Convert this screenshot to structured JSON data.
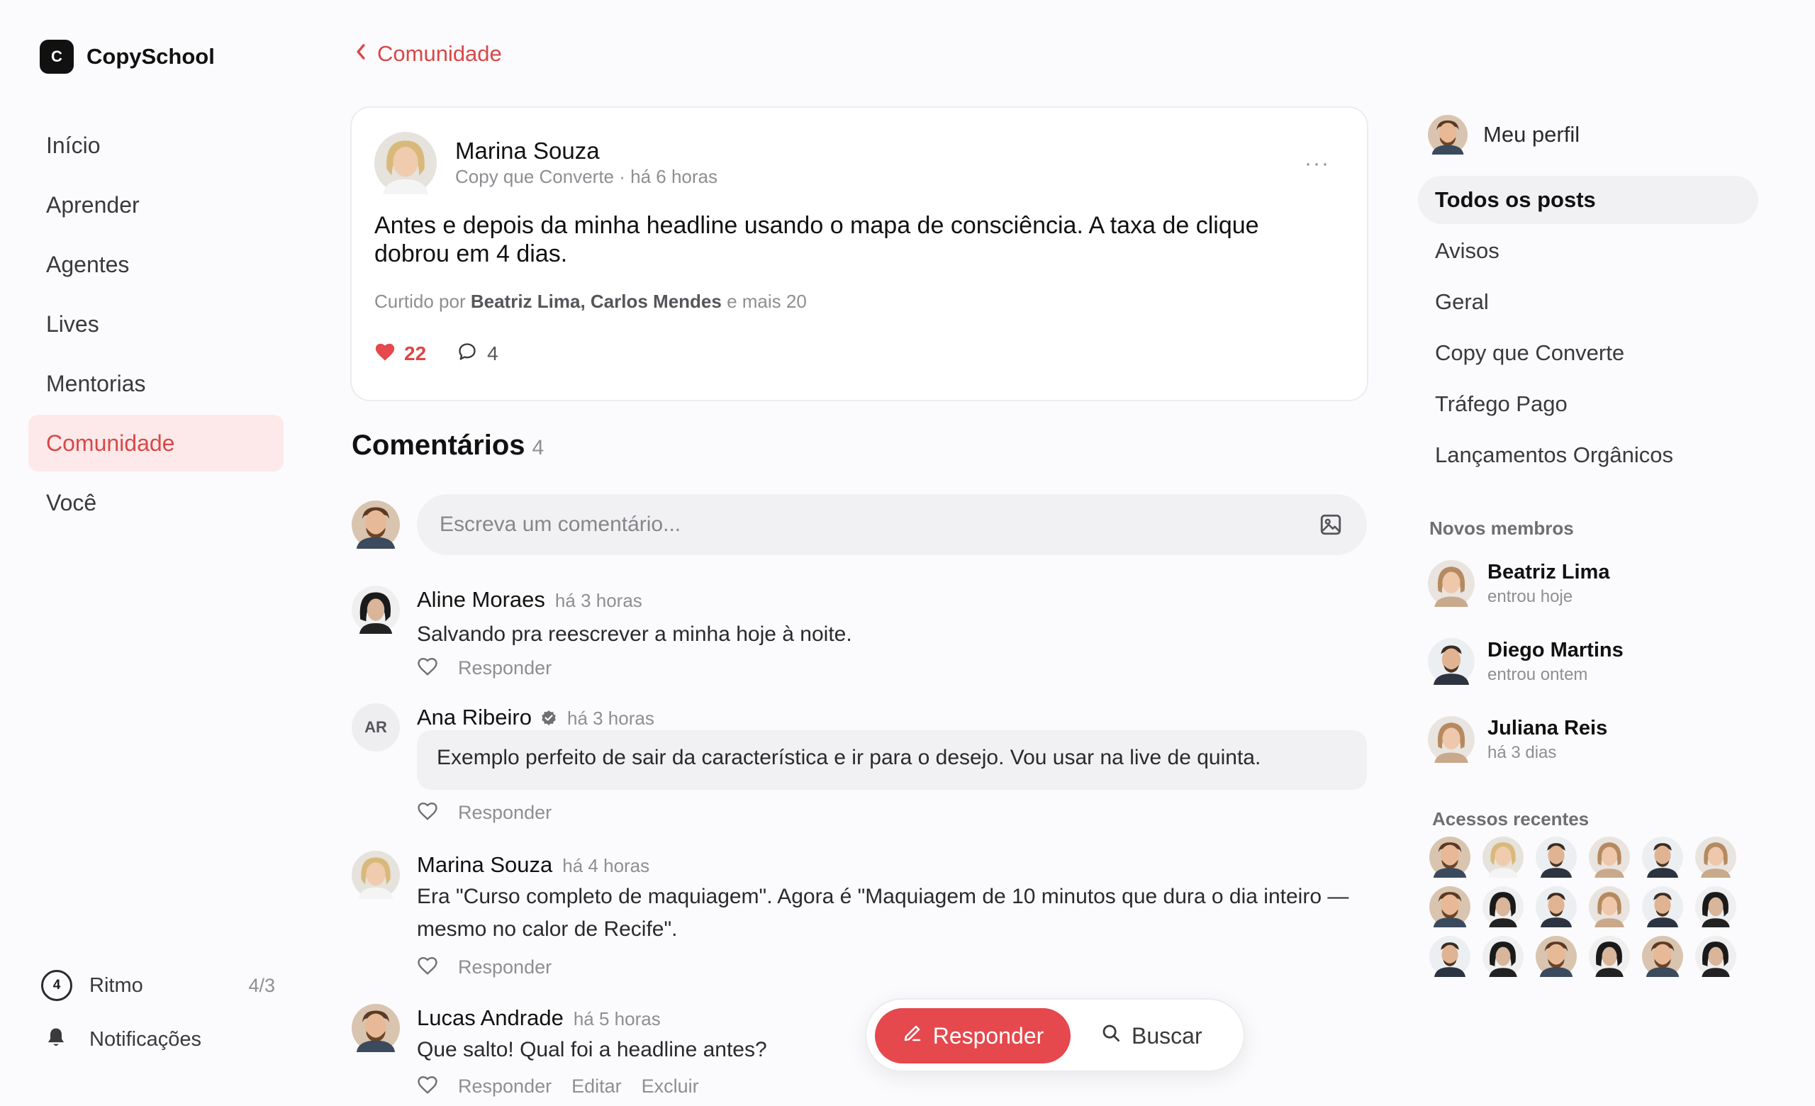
{
  "brand": {
    "logo_letter": "C",
    "name": "CopySchool"
  },
  "nav": {
    "items": [
      {
        "label": "Início",
        "active": false
      },
      {
        "label": "Aprender",
        "active": false
      },
      {
        "label": "Agentes",
        "active": false
      },
      {
        "label": "Lives",
        "active": false
      },
      {
        "label": "Mentorias",
        "active": false
      },
      {
        "label": "Comunidade",
        "active": true
      },
      {
        "label": "Você",
        "active": false
      }
    ],
    "ritmo": {
      "ring_value": "4",
      "label": "Ritmo",
      "count": "4/3"
    },
    "notifications_label": "Notificações"
  },
  "breadcrumb": {
    "back_label": "Comunidade"
  },
  "post": {
    "author": "Marina Souza",
    "meta": "Copy que Converte · há 6 horas",
    "more": "···",
    "body": "Antes e depois da minha headline usando o mapa de consciência. A taxa de clique dobrou em 4 dias.",
    "liked_prefix": "Curtido por ",
    "liked_names": "Beatriz Lima, Carlos Mendes",
    "liked_suffix": " e mais 20",
    "likes": "22",
    "comments": "4"
  },
  "comments_section": {
    "title": "Comentários",
    "count": "4",
    "composer_placeholder": "Escreva um comentário..."
  },
  "comments": [
    {
      "name": "Aline Moraes",
      "time": "há 3 horas",
      "text": "Salvando pra reescrever a minha hoje à noite.",
      "reply": "Responder"
    },
    {
      "name": "Ana Ribeiro",
      "initials": "AR",
      "verified": true,
      "time": "há 3 horas",
      "text": "Exemplo perfeito de sair da característica e ir para o desejo. Vou usar na live de quinta.",
      "reply": "Responder"
    },
    {
      "name": "Marina Souza",
      "time": "há 4 horas",
      "text": "Era \"Curso completo de maquiagem\". Agora é \"Maquiagem de 10 minutos que dura o dia inteiro — mesmo no calor de Recife\".",
      "reply": "Responder"
    },
    {
      "name": "Lucas Andrade",
      "time": "há 5 horas",
      "text": "Que salto! Qual foi a headline antes?",
      "reply": "Responder",
      "edit": "Editar",
      "delete": "Excluir"
    }
  ],
  "floatbar": {
    "reply_label": "Responder",
    "search_label": "Buscar"
  },
  "right": {
    "profile_label": "Meu perfil",
    "categories": [
      {
        "label": "Todos os posts",
        "active": true
      },
      {
        "label": "Avisos",
        "active": false
      },
      {
        "label": "Geral",
        "active": false
      },
      {
        "label": "Copy que Converte",
        "active": false
      },
      {
        "label": "Tráfego Pago",
        "active": false
      },
      {
        "label": "Lançamentos Orgânicos",
        "active": false
      }
    ],
    "new_members_title": "Novos membros",
    "new_members": [
      {
        "name": "Beatriz Lima",
        "sub": "entrou hoje"
      },
      {
        "name": "Diego Martins",
        "sub": "entrou ontem"
      },
      {
        "name": "Juliana Reis",
        "sub": "há 3 dias"
      }
    ],
    "recent_title": "Acessos recentes"
  },
  "colors": {
    "accent": "#e5484d",
    "accent_text": "#d94848",
    "active_nav_bg": "#fde9e9"
  }
}
